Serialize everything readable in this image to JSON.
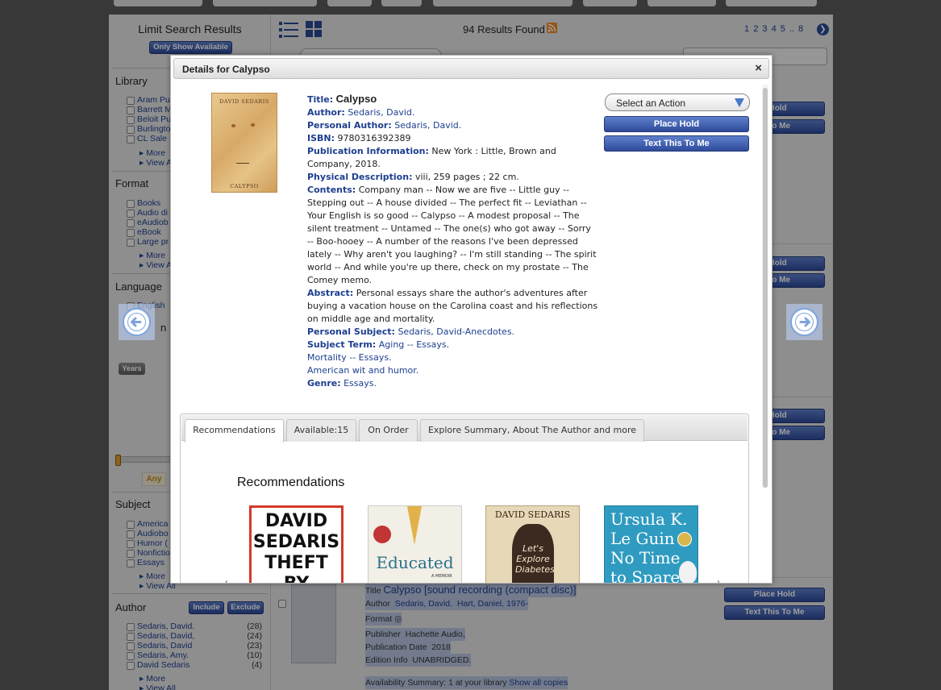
{
  "page": {
    "results_found": "94 Results Found",
    "pagination": [
      "1",
      "2",
      "3",
      "4",
      "5",
      "..",
      "8"
    ],
    "sidebar": {
      "title": "Limit Search Results",
      "only_available": "Only Show Available",
      "library": {
        "heading": "Library",
        "items": [
          "Aram Pu",
          "Barrett M",
          "Beloit Pu",
          "Burlingto",
          "CL Sale"
        ],
        "more": "More",
        "view": "View A"
      },
      "format": {
        "heading": "Format",
        "items": [
          "Books",
          "Audio di",
          "eAudiob",
          "eBook",
          "Large pr"
        ],
        "more": "More",
        "view": "View A"
      },
      "language": {
        "heading": "Language",
        "items": [
          "English"
        ]
      },
      "publication_heading_partial": "n",
      "years_button": "Years",
      "any_label": "Any",
      "subject": {
        "heading": "Subject",
        "items": [
          "America",
          "Audiobo",
          "Humor (",
          "Nonfictio",
          "Essays"
        ],
        "more": "More",
        "view_all": "View All"
      },
      "author": {
        "heading": "Author",
        "include": "Include",
        "exclude": "Exclude",
        "items": [
          {
            "name": "Sedaris, David.",
            "count": "(28)"
          },
          {
            "name": "Sedaris, David,",
            "count": "(24)"
          },
          {
            "name": "Sedaris, David",
            "count": "(23)"
          },
          {
            "name": "Sedaris, Amy.",
            "count": "(10)"
          },
          {
            "name": "David Sedaris",
            "count": "(4)"
          }
        ],
        "more": "More",
        "view_all": "View All"
      }
    },
    "background_buttons": {
      "place_hold_partial": "e Hold",
      "text_partial": "is To Me",
      "place_hold": "Place Hold",
      "text_this_to_me": "Text This To Me"
    },
    "background_result": {
      "title_label": "Title",
      "title": "Calypso [sound recording (compact disc)]",
      "author_label": "Author",
      "author": "Sedaris, David.",
      "author2": "Hart, Daniel, 1976-",
      "format_label": "Format",
      "publisher_label": "Publisher",
      "publisher": "Hachette Audio,",
      "pubdate_label": "Publication Date",
      "pubdate": "2018",
      "edition_label": "Edition Info",
      "edition": "UNABRIDGED.",
      "availability": "Availability Summary: 1 at your library",
      "show_all": "Show all copies"
    }
  },
  "modal": {
    "title": "Details for Calypso",
    "close": "×",
    "cover": {
      "author": "DAVID SEDARIS",
      "title": "CALYPSO"
    },
    "details": {
      "title_label": "Title:",
      "title": "Calypso",
      "author_label": "Author:",
      "author": "Sedaris, David.",
      "personal_author_label": "Personal Author:",
      "personal_author": "Sedaris, David.",
      "isbn_label": "ISBN:",
      "isbn": "9780316392389",
      "pubinfo_label": "Publication Information:",
      "pubinfo_line1": "New York : Little, Brown and",
      "pubinfo_line2": "Company, 2018.",
      "physdesc_label": "Physical Description:",
      "physdesc": "viii, 259 pages ; 22 cm.",
      "contents_label": "Contents:",
      "contents_lines": [
        "Company man -- Now we are five -- Little guy --",
        "Stepping out -- A house divided -- The perfect fit -- Leviathan --",
        "Your English is so good -- Calypso -- A modest proposal -- The",
        "silent treatment -- Untamed -- The one(s) who got away -- Sorry",
        "-- Boo-hooey -- A number of the reasons I've been depressed",
        "lately -- Why aren't you laughing? -- I'm still standing -- The spirit",
        "world -- And while you're up there, check on my prostate -- The",
        "Comey memo."
      ],
      "abstract_label": "Abstract:",
      "abstract_lines": [
        "Personal essays share the author's adventures after",
        "buying a vacation house on the Carolina coast and his reflections",
        "on middle age and mortality."
      ],
      "personal_subject_label": "Personal Subject:",
      "personal_subject": "Sedaris, David-Anecdotes.",
      "subject_term_label": "Subject Term:",
      "subject_terms": [
        "Aging -- Essays.",
        "Mortality -- Essays.",
        "American wit and humor."
      ],
      "genre_label": "Genre:",
      "genre": "Essays."
    },
    "actions": {
      "select": "Select an Action",
      "place_hold": "Place Hold",
      "text_this_to_me": "Text This To Me"
    },
    "tabs": [
      "Recommendations",
      "Available:15",
      "On Order",
      "Explore Summary, About The Author and more"
    ],
    "recommendations_title": "Recommendations",
    "recommendations": [
      {
        "cover_text": [
          "DAVID",
          "SEDARIS",
          "THEFT BY"
        ]
      },
      {
        "cover_text": [
          "Educated",
          "A MEMOIR"
        ]
      },
      {
        "cover_text": [
          "DAVID SEDARIS",
          "Let's",
          "Explore",
          "Diabetes"
        ]
      },
      {
        "cover_text": [
          "Ursula K.",
          "Le Guin",
          "No Time",
          "to Spare"
        ]
      }
    ]
  },
  "colors": {
    "link": "#1d3f8f",
    "button_blue": "#3a57a8",
    "overlay": "rgba(0,0,0,0.38)"
  }
}
